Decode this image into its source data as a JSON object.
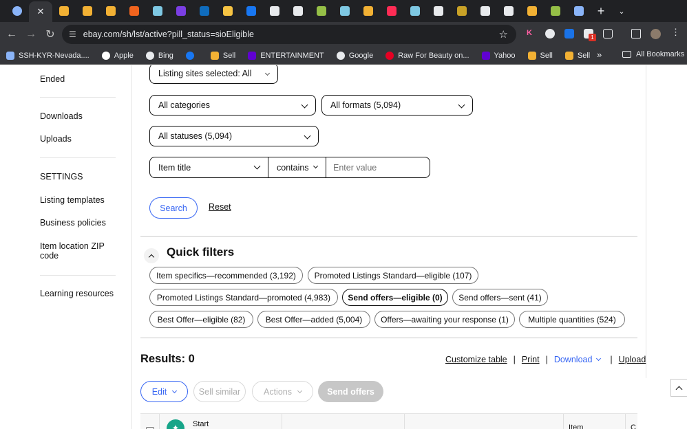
{
  "browser": {
    "tabs": [
      {
        "icon": "globe-icon",
        "color": "#8ab4f8",
        "shape": "circle"
      },
      {
        "icon": "close-icon",
        "active": true
      },
      {
        "icon": "sell-icon",
        "color": "#f2b134"
      },
      {
        "icon": "sell-icon",
        "color": "#f2b134"
      },
      {
        "icon": "sell-icon",
        "color": "#f2b134"
      },
      {
        "icon": "etsy-icon",
        "color": "#f1641e"
      },
      {
        "icon": "diamond-icon",
        "color": "#7ec8e3"
      },
      {
        "icon": "mail-icon",
        "color": "#7b3fe4"
      },
      {
        "icon": "outlook-icon",
        "color": "#0f6cbd"
      },
      {
        "icon": "dollar-icon",
        "color": "#f6c343"
      },
      {
        "icon": "meta-icon",
        "color": "#1877f2"
      },
      {
        "icon": "ghost-icon",
        "color": "#e8eaed"
      },
      {
        "icon": "x-icon",
        "color": "#e8eaed"
      },
      {
        "icon": "shopify-icon",
        "color": "#95bf47"
      },
      {
        "icon": "diamond-icon",
        "color": "#7ec8e3"
      },
      {
        "icon": "sell-icon",
        "color": "#f2b134"
      },
      {
        "icon": "tiktok-icon",
        "color": "#fe2c55"
      },
      {
        "icon": "diamond-icon",
        "color": "#7ec8e3"
      },
      {
        "icon": "chatgpt-icon",
        "color": "#e8eaed"
      },
      {
        "icon": "seal-icon",
        "color": "#c9a227"
      },
      {
        "icon": "apple-icon",
        "color": "#e8eaed"
      },
      {
        "icon": "chatgpt-icon",
        "color": "#e8eaed"
      },
      {
        "icon": "sell-icon",
        "color": "#f2b134"
      },
      {
        "icon": "shopify-icon",
        "color": "#95bf47"
      },
      {
        "icon": "globe-icon",
        "color": "#8ab4f8"
      }
    ],
    "url": "ebay.com/sh/lst/active?pill_status=sioEligible",
    "extension_badge": "1",
    "bookmarks": [
      {
        "label": "SSH-KYR-Nevada....",
        "icon": "grid-icon",
        "color": "#8ab4f8"
      },
      {
        "label": "Apple",
        "icon": "apple-icon",
        "color": "#ffffff"
      },
      {
        "label": "Bing",
        "icon": "bing-icon",
        "color": "#e8eaed"
      },
      {
        "label": "",
        "icon": "facebook-icon",
        "color": "#1877f2"
      },
      {
        "label": "Sell",
        "icon": "sell-icon",
        "color": "#f2b134"
      },
      {
        "label": "ENTERTAINMENT",
        "icon": "yahoo-icon",
        "color": "#6001d2"
      },
      {
        "label": "Google",
        "icon": "google-icon",
        "color": "#e8eaed"
      },
      {
        "label": "Raw For Beauty on...",
        "icon": "pinterest-icon",
        "color": "#e60023"
      },
      {
        "label": "Yahoo",
        "icon": "yahoo-icon",
        "color": "#6001d2"
      },
      {
        "label": "Sell",
        "icon": "sell-icon",
        "color": "#f2b134"
      },
      {
        "label": "Sell",
        "icon": "sell-icon",
        "color": "#f2b134"
      }
    ],
    "all_bookmarks": "All Bookmarks"
  },
  "sidebar": {
    "items": [
      "Ended",
      "Downloads",
      "Uploads",
      "SETTINGS",
      "Listing templates",
      "Business policies",
      "Item location ZIP code",
      "Learning resources"
    ]
  },
  "filters": {
    "listing_sites": "Listing sites selected: All",
    "categories": "All categories",
    "formats": "All formats (5,094)",
    "statuses": "All statuses (5,094)",
    "field": "Item title",
    "operator": "contains",
    "value_placeholder": "Enter value",
    "search_label": "Search",
    "reset_label": "Reset"
  },
  "quick_filters": {
    "title": "Quick filters",
    "pills": [
      "Item specifics—recommended (3,192)",
      "Promoted Listings Standard—eligible (107)",
      "Promoted Listings Standard—promoted (4,983)",
      "Send offers—eligible (0)",
      "Send offers—sent (41)",
      "Best Offer—eligible (82)",
      "Best Offer—added (5,004)",
      "Offers—awaiting your response (1)",
      "Multiple quantities (524)"
    ],
    "selected": "Send offers—eligible (0)"
  },
  "results": {
    "label": "Results: 0",
    "links": {
      "customize": "Customize table",
      "print": "Print",
      "download": "Download",
      "upload": "Upload"
    },
    "separator": "|"
  },
  "toolbar": {
    "edit": "Edit",
    "sell_similar": "Sell similar",
    "actions": "Actions",
    "send_offers": "Send offers"
  },
  "table": {
    "headers": {
      "start": "Start",
      "item": "Item",
      "truncated": "C"
    }
  },
  "colors": {
    "ebay_blue": "#3665f3",
    "chrome_dark": "#202124",
    "chrome_toolbar": "#35363a"
  }
}
